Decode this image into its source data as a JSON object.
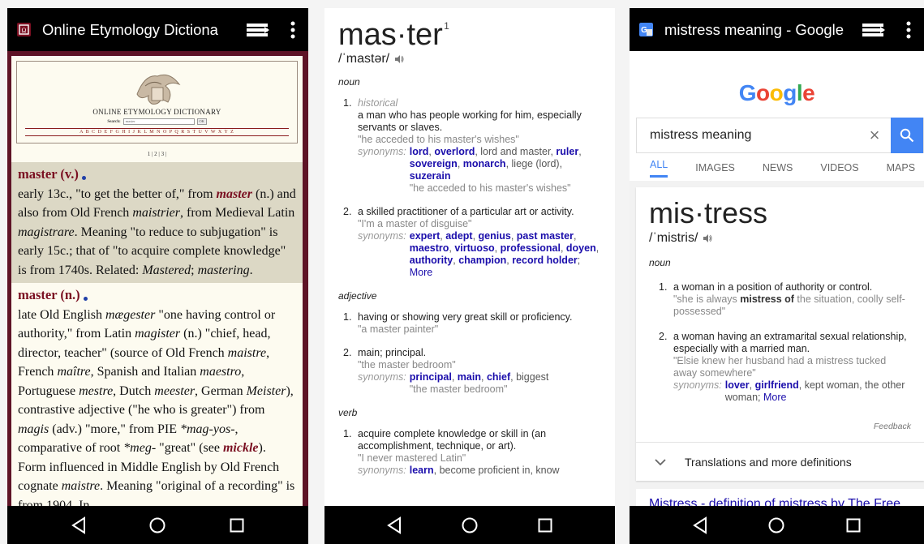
{
  "phone1": {
    "title": "Online Etymology Dictiona",
    "site_title": "ONLINE ETYMOLOGY DICTIONARY",
    "search_label": "Search:",
    "search_value": "master",
    "ok_label": "OK",
    "alphabet": "A B C D E F G H I J K L M N O P Q R S T U V W X Y Z",
    "pager": "1 | 2 | 3 |",
    "entry1": {
      "head": "master (v.)",
      "t1": "early 13c., \"to get the better of,\" from ",
      "ref1": "master",
      "t2": " (n.) and also from Old French ",
      "i1": "maistrier",
      "t3": ", from Medieval Latin ",
      "i2": "magistrare",
      "t4": ". Meaning \"to reduce to subjugation\" is early 15c.; that of \"to acquire complete knowledge\" is from 1740s. Related: ",
      "i3": "Mastered",
      "t5": "; ",
      "i4": "mastering",
      "t6": "."
    },
    "entry2": {
      "head": "master (n.)",
      "t1": "late Old English ",
      "i1": "mægester",
      "t2": " \"one having control or authority,\" from Latin ",
      "i2": "magister",
      "t3": " (n.) \"chief, head, director, teacher\" (source of Old French ",
      "i3": "maistre",
      "t4": ", French ",
      "i4": "maître",
      "t5": ", Spanish and Italian ",
      "i5": "maestro",
      "t6": ", Portuguese ",
      "i6": "mestre",
      "t7": ", Dutch ",
      "i7": "meester",
      "t8": ", German ",
      "i8": "Meister",
      "t9": "), contrastive adjective (\"he who is greater\") from ",
      "i9": "magis",
      "t10": " (adv.) \"more,\" from PIE ",
      "i10": "*mag-yos-",
      "t11": ", comparative of root ",
      "i11": "*meg-",
      "t12": " \"great\" (see ",
      "ref1": "mickle",
      "t13": "). Form influenced in Middle English by Old French cognate ",
      "i12": "maistre",
      "t14": ". Meaning \"original of a recording\" is from 1904. In"
    }
  },
  "phone2": {
    "word": "mas·ter",
    "sup": "1",
    "phonetic": "/ˈmastər/",
    "noun_label": "noun",
    "noun1": {
      "num": "1.",
      "label": "historical",
      "def": "a man who has people working for him, especially servants or slaves.",
      "example": "\"he acceded to his master's wishes\"",
      "syn_label": "synonyms:",
      "s1": "lord",
      "s2": "overlord",
      "s3": "lord and master",
      "s4": "ruler",
      "s5": "sovereign",
      "s6": "monarch",
      "s7": "liege (lord)",
      "s8": "suzerain",
      "syn_example": "\"he acceded to his master's wishes\""
    },
    "noun2": {
      "num": "2.",
      "def": "a skilled practitioner of a particular art or activity.",
      "example": "\"I'm a master of disguise\"",
      "syn_label": "synonyms:",
      "s1": "expert",
      "s2": "adept",
      "s3": "genius",
      "s4": "past master",
      "s5": "maestro",
      "s6": "virtuoso",
      "s7": "professional",
      "s8": "doyen",
      "s9": "authority",
      "s10": "champion",
      "s11": "record holder",
      "more": "More"
    },
    "adj_label": "adjective",
    "adj1": {
      "num": "1.",
      "def": "having or showing very great skill or proficiency.",
      "example": "\"a master painter\""
    },
    "adj2": {
      "num": "2.",
      "def": "main; principal.",
      "example": "\"the master bedroom\"",
      "syn_label": "synonyms:",
      "s1": "principal",
      "s2": "main",
      "s3": "chief",
      "s4": "biggest",
      "syn_example": "\"the master bedroom\""
    },
    "verb_label": "verb",
    "verb1": {
      "num": "1.",
      "def": "acquire complete knowledge or skill in (an accomplishment, technique, or art).",
      "example": "\"I never mastered Latin\"",
      "syn_label": "synonyms:",
      "s1": "learn",
      "s2": "become proficient in, know"
    }
  },
  "phone3": {
    "title": "mistress meaning - Google",
    "logo": "Google",
    "query": "mistress meaning",
    "clear": "×",
    "tabs": [
      "ALL",
      "IMAGES",
      "NEWS",
      "VIDEOS",
      "MAPS"
    ],
    "word": "mis·tress",
    "phonetic": "/ˈmistris/",
    "noun_label": "noun",
    "s1": {
      "num": "1.",
      "def": "a woman in a position of authority or control.",
      "ex_a": "\"she is always ",
      "ex_b": "mistress of",
      "ex_c": " the situation, coolly self-possessed\""
    },
    "s2": {
      "num": "2.",
      "def": "a woman having an extramarital sexual relationship, especially with a married man.",
      "example": "\"Elsie knew her husband had a mistress tucked away somewhere\"",
      "syn_label": "synonyms:",
      "s1": "lover",
      "s2": "girlfriend",
      "s3": "kept woman, the other woman;",
      "more": "More"
    },
    "feedback": "Feedback",
    "translations": "Translations and more definitions",
    "result_title": "Mistress - definition of mistress by The Free"
  },
  "colors": {
    "maroon": "#5e1326",
    "google_blue": "#4285f4",
    "link_blue": "#1a0dab"
  }
}
